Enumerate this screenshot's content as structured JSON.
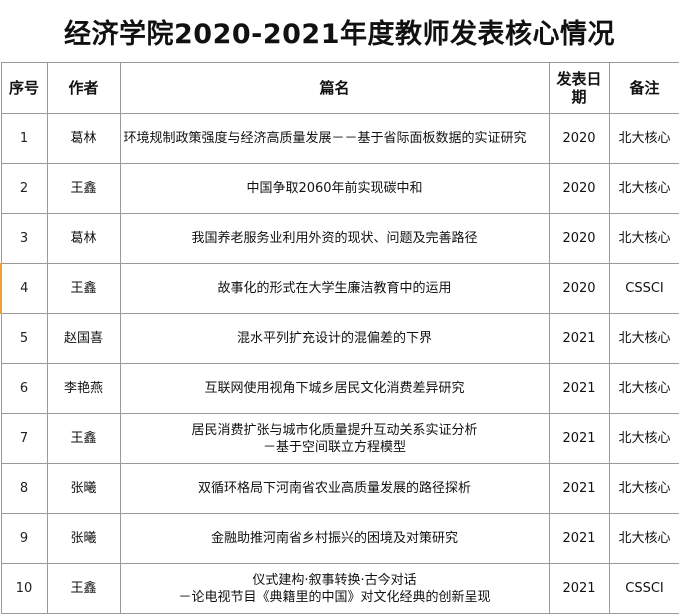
{
  "page_title": "经济学院2020-2021年度教师发表核心情况",
  "columns": [
    "序号",
    "作者",
    "篇名",
    "发表日期",
    "备注"
  ],
  "rows": [
    {
      "no": "1",
      "author": "葛林",
      "title": "环境规制政策强度与经济高质量发展－－基于省际面板数据的实证研究",
      "year": "2020",
      "note": "北大核心"
    },
    {
      "no": "2",
      "author": "王鑫",
      "title": "中国争取2060年前实现碳中和",
      "year": "2020",
      "note": "北大核心"
    },
    {
      "no": "3",
      "author": "葛林",
      "title": "我国养老服务业利用外资的现状、问题及完善路径",
      "year": "2020",
      "note": "北大核心"
    },
    {
      "no": "4",
      "author": "王鑫",
      "title": "故事化的形式在大学生廉洁教育中的运用",
      "year": "2020",
      "note": "CSSCI"
    },
    {
      "no": "5",
      "author": "赵国喜",
      "title": "混水平列扩充设计的混偏差的下界",
      "year": "2021",
      "note": "北大核心"
    },
    {
      "no": "6",
      "author": "李艳燕",
      "title": "互联网使用视角下城乡居民文化消费差异研究",
      "year": "2021",
      "note": "北大核心"
    },
    {
      "no": "7",
      "author": "王鑫",
      "title": "居民消费扩张与城市化质量提升互动关系实证分析\n－基于空间联立方程模型",
      "year": "2021",
      "note": "北大核心"
    },
    {
      "no": "8",
      "author": "张曦",
      "title": "双循环格局下河南省农业高质量发展的路径探析",
      "year": "2021",
      "note": "北大核心"
    },
    {
      "no": "9",
      "author": "张曦",
      "title": "金融助推河南省乡村振兴的困境及对策研究",
      "year": "2021",
      "note": "北大核心"
    },
    {
      "no": "10",
      "author": "王鑫",
      "title": "仪式建构·叙事转换·古今对话\n－论电视节目《典籍里的中国》对文化经典的创新呈现",
      "year": "2021",
      "note": "CSSCI"
    }
  ]
}
